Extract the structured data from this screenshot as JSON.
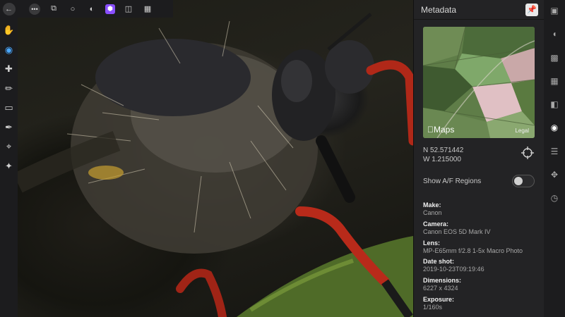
{
  "panel": {
    "title": "Metadata",
    "pin_icon": "pin-icon"
  },
  "map": {
    "brand": "Maps",
    "legal": "Legal"
  },
  "location": {
    "lat": "N 52.571442",
    "lon": "W 1.215000"
  },
  "af_regions": {
    "label": "Show A/F Regions",
    "enabled": false
  },
  "metadata": [
    {
      "key": "Make:",
      "value": "Canon"
    },
    {
      "key": "Camera:",
      "value": "Canon EOS 5D Mark IV"
    },
    {
      "key": "Lens:",
      "value": "MP-E65mm f/2.8 1-5x Macro Photo"
    },
    {
      "key": "Date shot:",
      "value": "2019-10-23T09:19:46"
    },
    {
      "key": "Dimensions:",
      "value": "6227 x 4324"
    },
    {
      "key": "Exposure:",
      "value": "1/160s"
    }
  ],
  "left_tools": [
    "back-arrow-icon",
    "hand-icon",
    "eye-icon",
    "bandage-icon",
    "brush-icon",
    "eraser-icon",
    "eyedropper-icon",
    "crop-icon",
    "wand-icon"
  ],
  "top_tools": [
    "more-icon",
    "develop-icon",
    "circle-icon",
    "tone-icon",
    "liquify-icon",
    "split-icon",
    "export-icon"
  ],
  "right_tools": [
    "expand-icon",
    "histogram-icon",
    "channels-icon",
    "navigator-icon",
    "brushes-icon",
    "camera-icon",
    "layers-icon",
    "transform-icon",
    "history-icon"
  ],
  "colors": {
    "accent": "#4aa8ff",
    "purple_tool": "#8a4fff"
  }
}
